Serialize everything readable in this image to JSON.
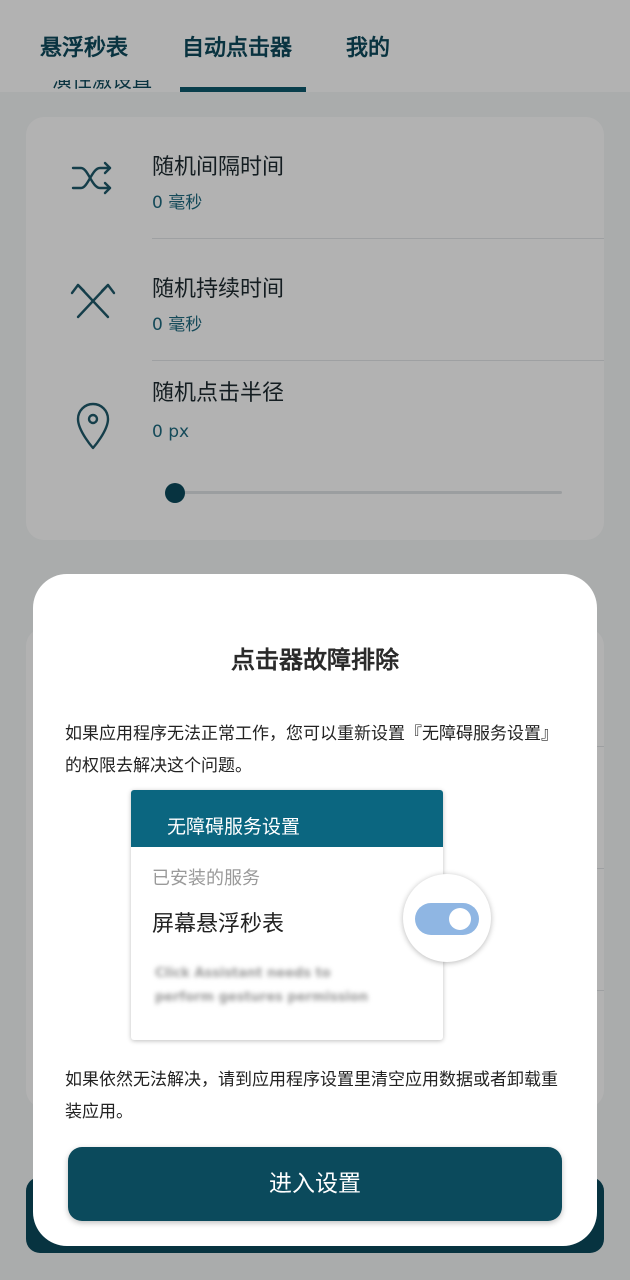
{
  "tabs": [
    {
      "label": "悬浮秒表",
      "active": false
    },
    {
      "label": "自动点击器",
      "active": true
    },
    {
      "label": "我的",
      "active": false
    }
  ],
  "section_peek": "演性激设直",
  "settings": {
    "random_interval": {
      "title": "随机间隔时间",
      "value": "0 毫秒",
      "icon": "shuffle-icon"
    },
    "random_duration": {
      "title": "随机持续时间",
      "value": "0 毫秒",
      "icon": "cross-arrows-icon"
    },
    "random_radius": {
      "title": "随机点击半径",
      "value": "0 px",
      "icon": "location-pin-icon",
      "slider_fraction": 0.0
    }
  },
  "dialog": {
    "title": "点击器故障排除",
    "text_1": "如果应用程序无法正常工作，您可以重新设置『无障碍服务设置』的权限去解决这个问题。",
    "illustration": {
      "header": "无障碍服务设置",
      "installed_label": "已安装的服务",
      "service_name": "屏幕悬浮秒表",
      "blurred_line_1": "Click Assistant needs to",
      "blurred_line_2": "perform gestures permission",
      "toggle_on": true
    },
    "text_2": "如果依然无法解决，请到应用程序设置里清空应用数据或者卸载重装应用。",
    "button_label": "进入设置"
  },
  "colors": {
    "primary": "#0b4a5c",
    "accent_header": "#0b6680",
    "toggle_track": "#8fb6e3",
    "scrim": "rgba(0,0,0,0.30)"
  }
}
